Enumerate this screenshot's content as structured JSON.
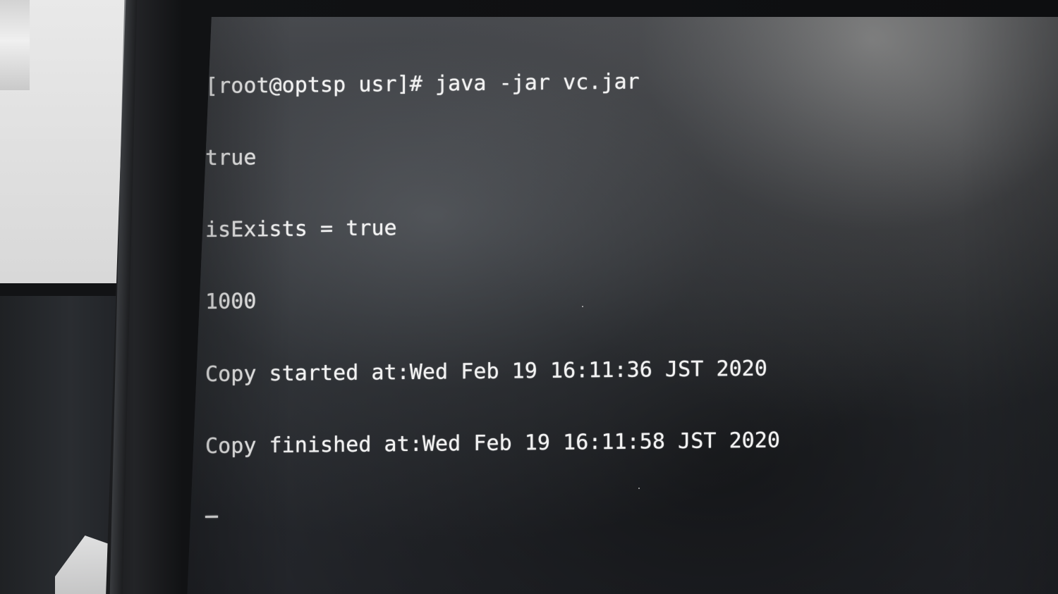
{
  "terminal": {
    "prompt_line": "[root@optsp usr]# java -jar vc.jar",
    "output_lines": [
      "true",
      "isExists = true",
      "1000",
      "Copy started at:Wed Feb 19 16:11:36 JST 2020",
      "Copy finished at:Wed Feb 19 16:11:58 JST 2020"
    ],
    "cursor_icon": "text-cursor-icon"
  },
  "colors": {
    "screen": "#2a2d31",
    "terminal_text": "#f2f2f2",
    "bezel": "#111214",
    "wall": "#d9d9d9"
  }
}
